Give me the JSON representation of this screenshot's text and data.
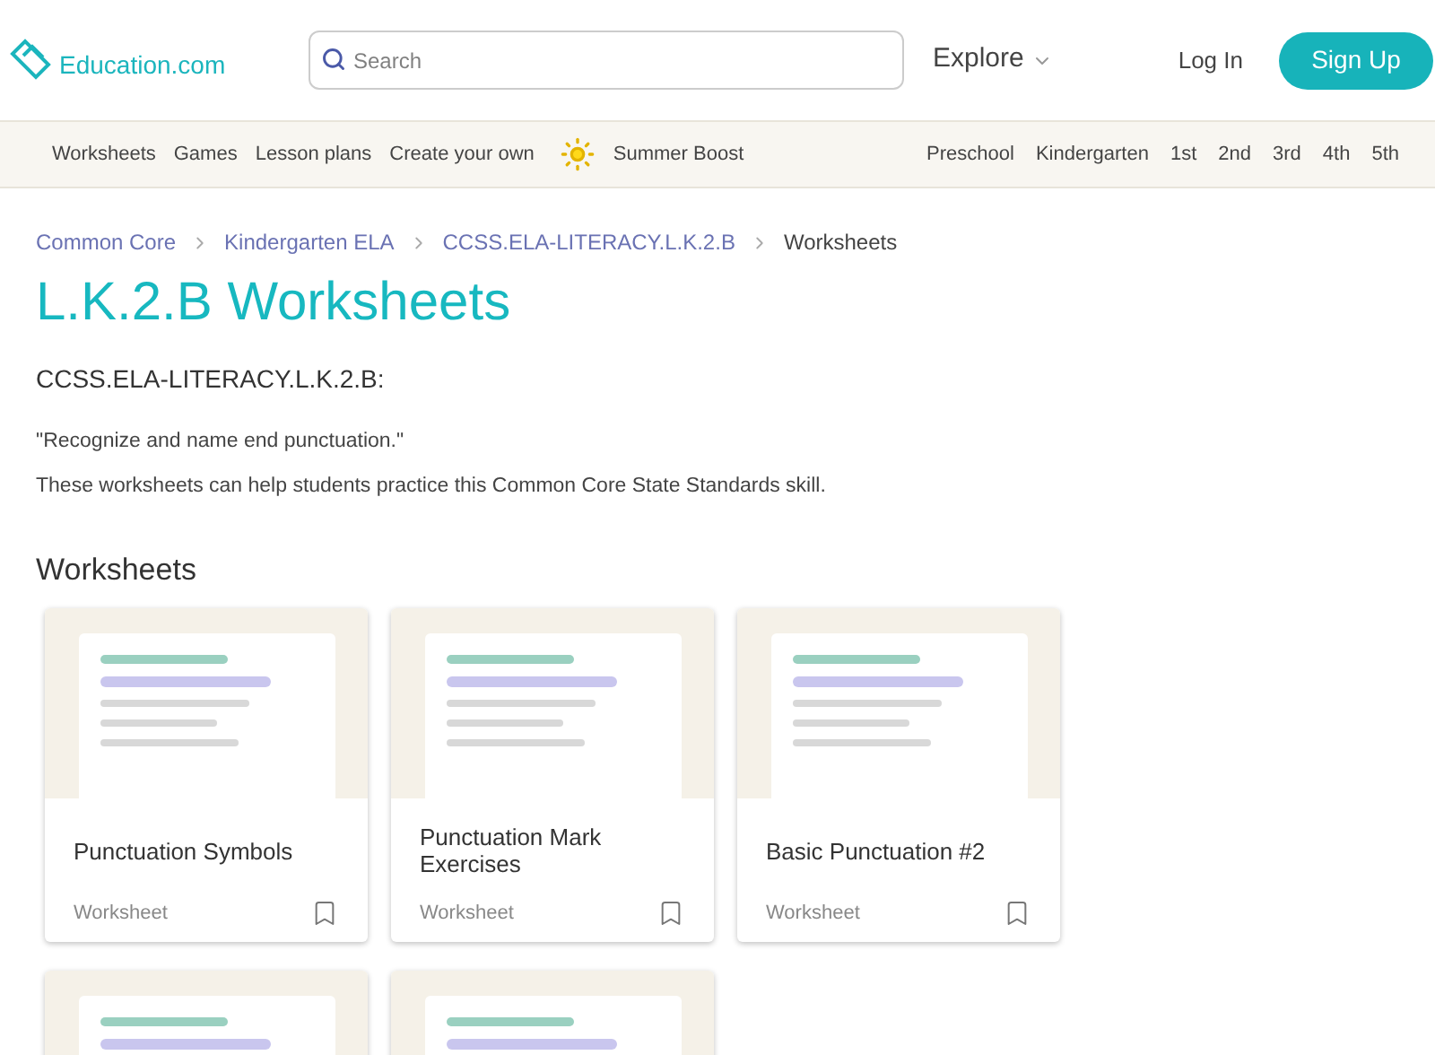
{
  "header": {
    "logo": "Education.com",
    "search": {
      "placeholder": "Search"
    },
    "explore": "Explore",
    "login": "Log In",
    "signup": "Sign Up"
  },
  "nav": {
    "left": [
      "Worksheets",
      "Games",
      "Lesson plans",
      "Create your own"
    ],
    "boost": "Summer Boost",
    "grades": [
      "Preschool",
      "Kindergarten",
      "1st",
      "2nd",
      "3rd",
      "4th",
      "5th"
    ]
  },
  "breadcrumb": [
    {
      "label": "Common Core",
      "link": true
    },
    {
      "label": "Kindergarten ELA",
      "link": true
    },
    {
      "label": "CCSS.ELA-LITERACY.L.K.2.B",
      "link": true
    },
    {
      "label": "Worksheets",
      "link": false
    }
  ],
  "title": "L.K.2.B Worksheets",
  "standard": "CCSS.ELA-LITERACY.L.K.2.B:",
  "quote": "\"Recognize and name end punctuation.\"",
  "description": "These worksheets can help students practice this Common Core State Standards skill.",
  "section_title": "Worksheets",
  "cards": [
    {
      "kind": "full",
      "title": "Punctuation Symbols",
      "type": "Worksheet"
    },
    {
      "kind": "full",
      "title": "Punctuation Mark Exercises",
      "type": "Worksheet"
    },
    {
      "kind": "full",
      "title": "Basic Punctuation #2",
      "type": "Worksheet"
    },
    {
      "kind": "cut"
    },
    {
      "kind": "cut"
    }
  ]
}
